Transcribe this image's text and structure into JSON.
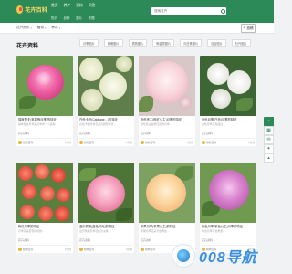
{
  "header": {
    "logo_text": "花卉百科",
    "nav": [
      {
        "label": "首页",
        "sub": "知识"
      },
      {
        "label": "养护",
        "sub": "品种"
      },
      {
        "label": "资料",
        "sub": "图片"
      },
      {
        "label": "问答",
        "sub": "专题"
      }
    ],
    "search_placeholder": "搜索花卉"
  },
  "subnav": {
    "items": [
      "花卉资讯",
      "植物",
      "养花"
    ],
    "contribute_label": "投稿"
  },
  "section": {
    "title": "花卉资料",
    "tags": [
      "月季图片",
      "玫瑰图片",
      "蔷薇图片",
      "郁金香图片",
      "向日葵图片",
      "百合图片",
      "牡丹图片"
    ]
  },
  "cards": [
    {
      "title": "猫咪瑟夫(苹果蜂月季)的特征",
      "desc": "猫咪瑟夫月季是月季的一个品种…",
      "category": "花卉资料",
      "author": "格物百科",
      "time": "2天前"
    },
    {
      "title": "白色卡柏(Cabbage…)的特征",
      "desc": "白色卡柏月季花朵为圆形杯状…",
      "category": "花卉资料",
      "author": "格物百科",
      "time": "2天前"
    },
    {
      "title": "粉色宫主(粉红公主)月季的特征",
      "desc": "粉色宫主是粉红色的月季…",
      "category": "花卉资料",
      "author": "格物百科",
      "time": "2天前"
    },
    {
      "title": "白色月季(白色)月季的特征",
      "desc": "白色月季花色纯白…",
      "category": "花卉资料",
      "author": "格物百科",
      "time": "2天前"
    },
    {
      "title": "粉红月季的特征",
      "desc": "月季花是蔷薇科植物…",
      "category": "花卉资料",
      "author": "格物百科",
      "time": "3天前"
    },
    {
      "title": "蓝乐佩斯(蓝色时光)的特征",
      "desc": "蓝乐佩斯月季花色为淡紫…",
      "category": "花卉资料",
      "author": "格物百科",
      "time": "3天前"
    },
    {
      "title": "苹果月季(苹果公主)的特征",
      "desc": "苹果月季花朵为杏黄色…",
      "category": "花卉资料",
      "author": "格物百科",
      "time": "3天前"
    },
    {
      "title": "紫色月季(紫色公主)月季的特征",
      "desc": "紫色月季花色艳丽…",
      "category": "花卉资料",
      "author": "格物百科",
      "time": "3天前"
    }
  ],
  "sidebar": {
    "icons": [
      "location-icon",
      "qrcode-icon",
      "chat-icon",
      "gift-icon",
      "top-icon"
    ]
  },
  "watermark": {
    "text": "008导航"
  },
  "colors": {
    "brand": "#2b8a57",
    "accent_yellow": "#ffd966"
  }
}
